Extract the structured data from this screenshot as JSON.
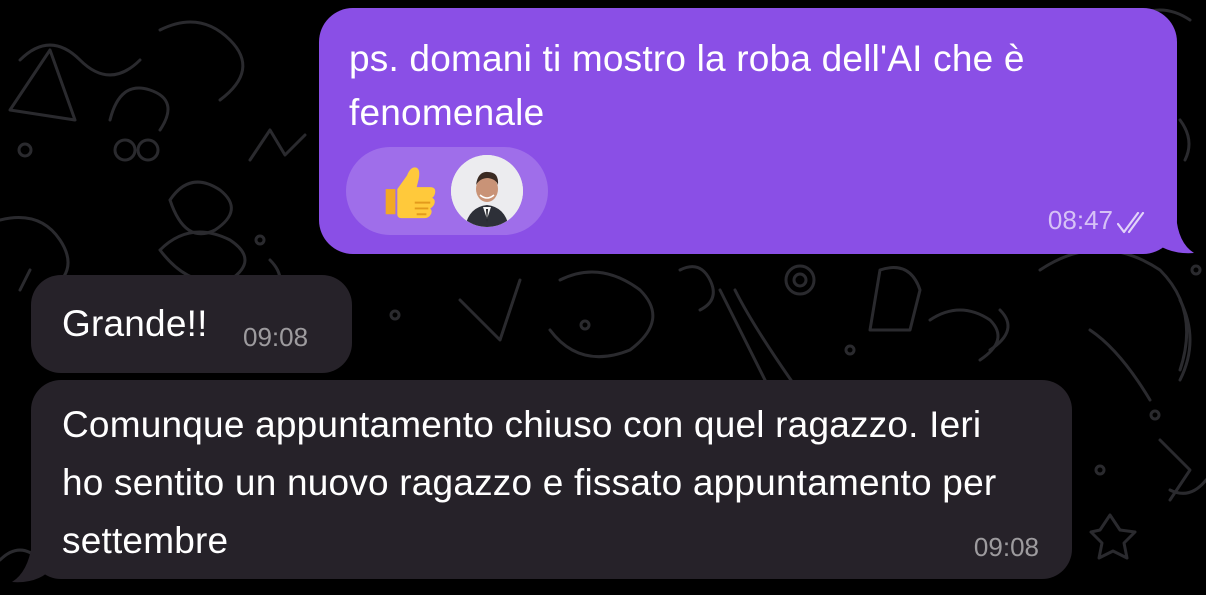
{
  "colors": {
    "background": "#000000",
    "outgoing_bubble": "#8a4fe6",
    "incoming_bubble": "#262229"
  },
  "messages": {
    "outgoing": {
      "text": "ps. domani ti mostro la roba dell'AI che è fenomenale",
      "time": "08:47",
      "status_icon": "double-check-icon",
      "reaction": {
        "emoji": "thumbs-up-icon",
        "avatar": "avatar"
      }
    },
    "incoming_1": {
      "text": "Grande!!",
      "time": "09:08"
    },
    "incoming_2": {
      "text": "Comunque appuntamento chiuso con quel ragazzo. Ieri ho sentito un nuovo ragazzo e fissato appuntamento per settembre",
      "time": "09:08"
    }
  }
}
